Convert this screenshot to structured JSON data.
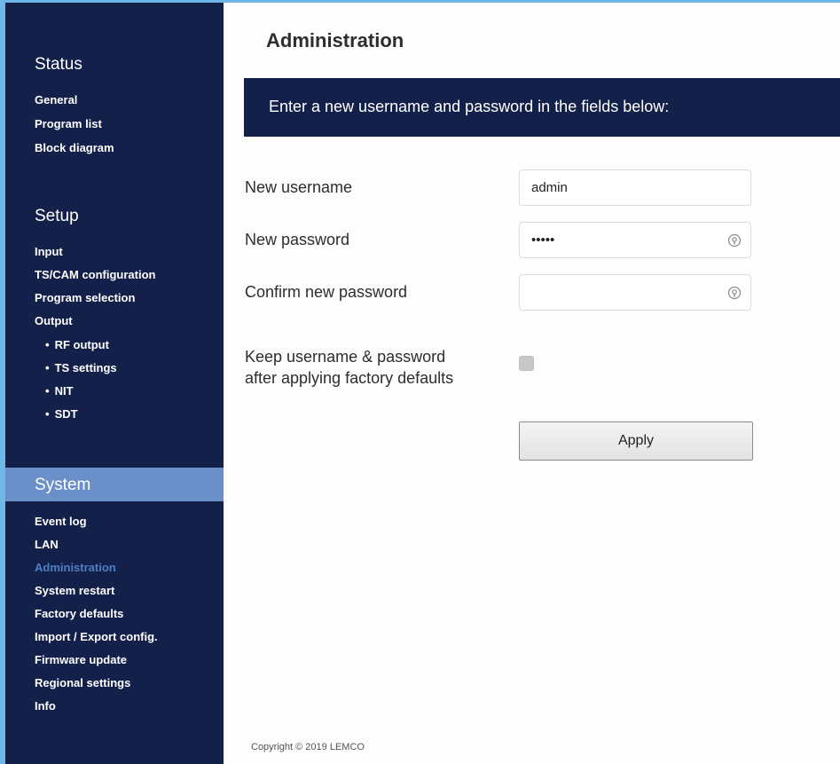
{
  "sidebar": {
    "status": {
      "title": "Status",
      "items": [
        "General",
        "Program list",
        "Block diagram"
      ]
    },
    "setup": {
      "title": "Setup",
      "items": [
        "Input",
        "TS/CAM configuration",
        "Program selection",
        "Output"
      ],
      "subitems": [
        "RF output",
        "TS settings",
        "NIT",
        "SDT"
      ]
    },
    "system": {
      "title": "System",
      "items": [
        "Event log",
        "LAN",
        "Administration",
        "System restart",
        "Factory defaults",
        "Import / Export config.",
        "Firmware update",
        "Regional settings",
        "Info"
      ],
      "active": "Administration"
    }
  },
  "main": {
    "title": "Administration",
    "banner": "Enter a new username and password in the fields below:",
    "form": {
      "username_label": "New username",
      "username_value": "admin",
      "password_label": "New password",
      "password_value": "•••••",
      "confirm_label": "Confirm new password",
      "confirm_value": "",
      "keep_label_line1": "Keep username & password",
      "keep_label_line2": "after applying factory defaults",
      "keep_checked": false,
      "apply_label": "Apply"
    },
    "copyright": "Copyright © 2019 LEMCO"
  },
  "colors": {
    "sidebar_bg": "#13204a",
    "system_band": "#6a8fc9",
    "active_link": "#4d7fc6",
    "frame_accent": "#6fb7e6"
  }
}
